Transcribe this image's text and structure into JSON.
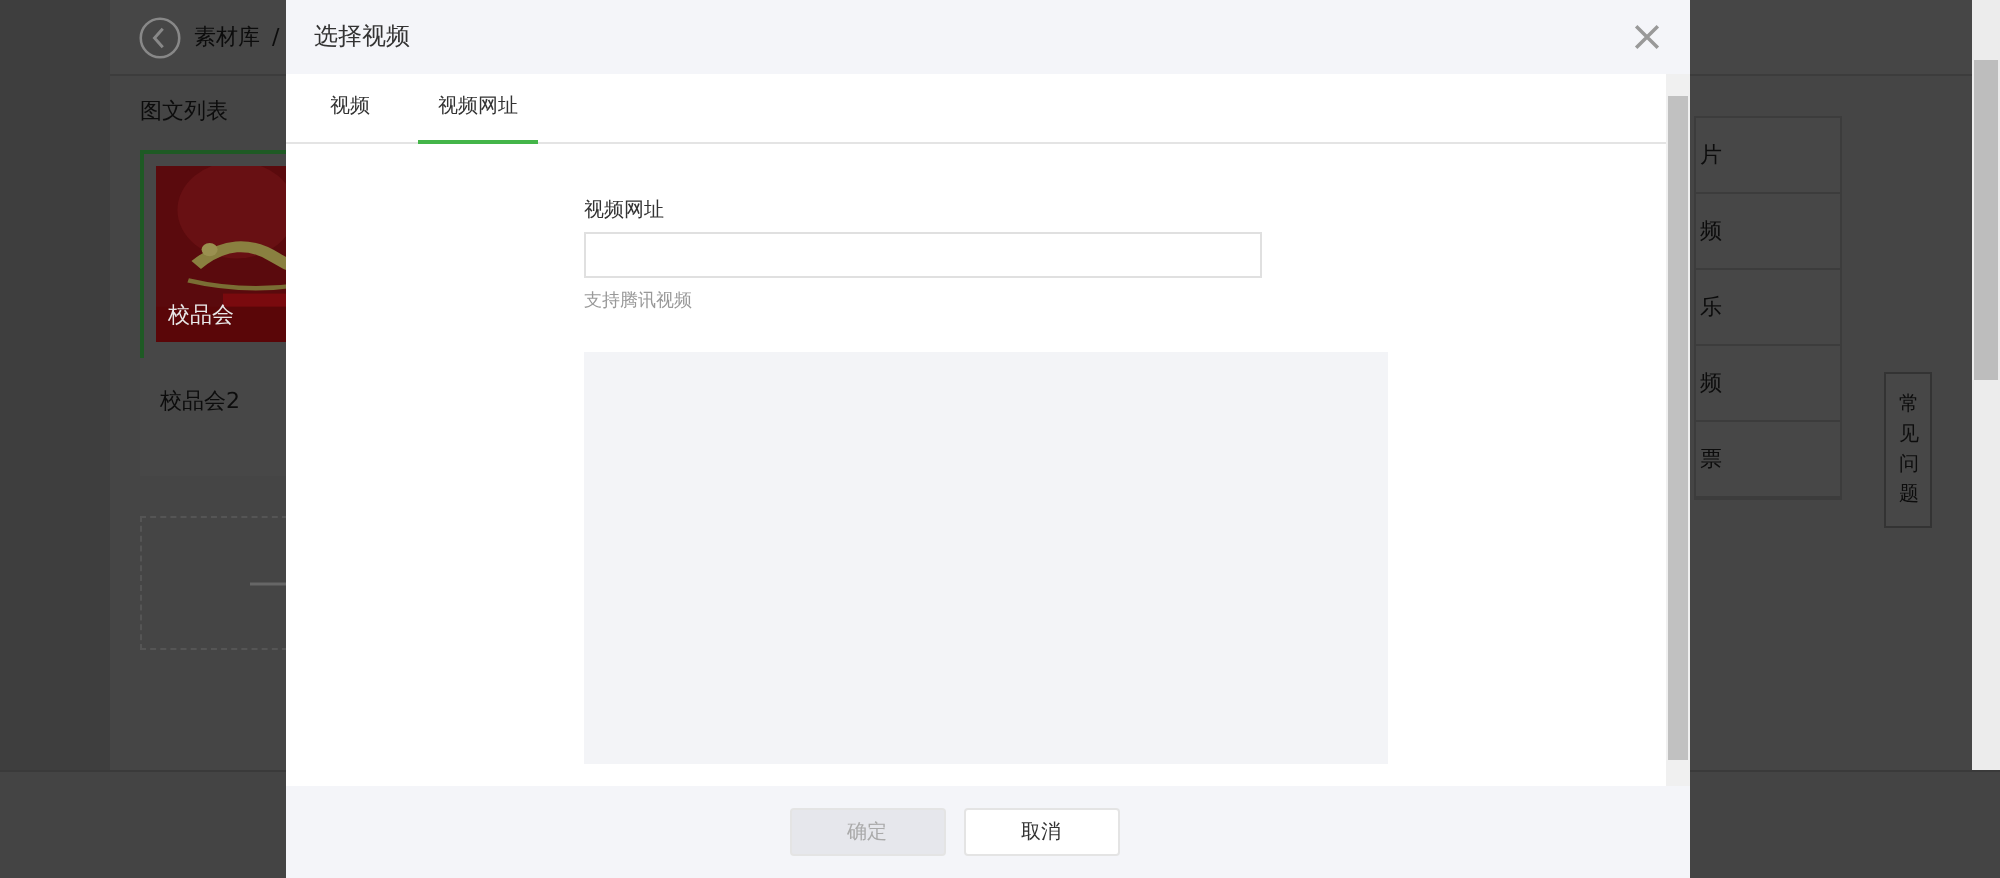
{
  "page": {
    "breadcrumb": {
      "link": "素材库",
      "separator": "/"
    },
    "section_title": "图文列表",
    "articles": [
      {
        "caption": "校品会",
        "title": "校品会2",
        "selected": true
      }
    ],
    "side_menu": [
      "片",
      "频",
      "乐",
      "频",
      "票"
    ],
    "help_button": "常见问题"
  },
  "dialog": {
    "title": "选择视频",
    "tabs": [
      {
        "label": "视频",
        "selected": false
      },
      {
        "label": "视频网址",
        "selected": true
      }
    ],
    "field": {
      "label": "视频网址"
    },
    "hint": "支持腾讯视频",
    "buttons": [
      {
        "label": "确定",
        "disabled": true
      },
      {
        "label": "取消",
        "disabled": false
      }
    ]
  }
}
